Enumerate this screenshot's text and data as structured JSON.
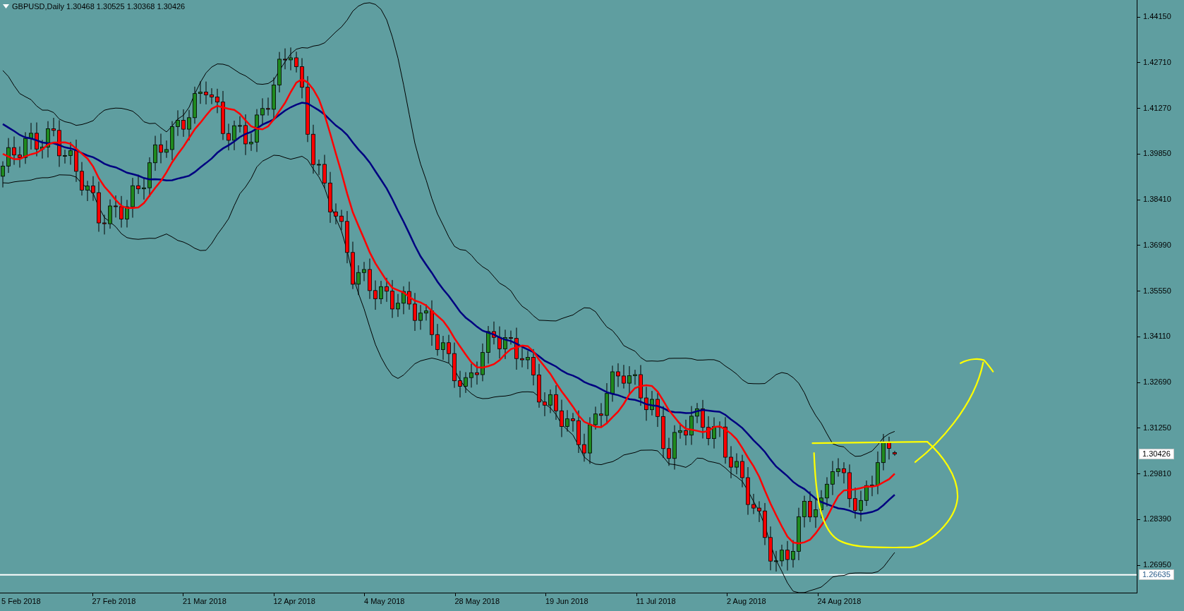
{
  "chart": {
    "header": "GBPUSD,Daily 1.30468 1.30525 1.30368 1.30426",
    "price_axis": [
      "1.44150",
      "1.42710",
      "1.41270",
      "1.39850",
      "1.38410",
      "1.36990",
      "1.35550",
      "1.34110",
      "1.32690",
      "1.31250",
      "1.29810",
      "1.28390",
      "1.26950"
    ],
    "price_markers": [
      {
        "kind": "current",
        "label": "1.30426"
      },
      {
        "kind": "line",
        "label": "1.26635"
      }
    ],
    "date_axis": [
      "5 Feb 2018",
      "27 Feb 2018",
      "21 Mar 2018",
      "12 Apr 2018",
      "4 May 2018",
      "28 May 2018",
      "19 Jun 2018",
      "11 Jul 2018",
      "2 Aug 2018",
      "24 Aug 2018"
    ]
  }
}
